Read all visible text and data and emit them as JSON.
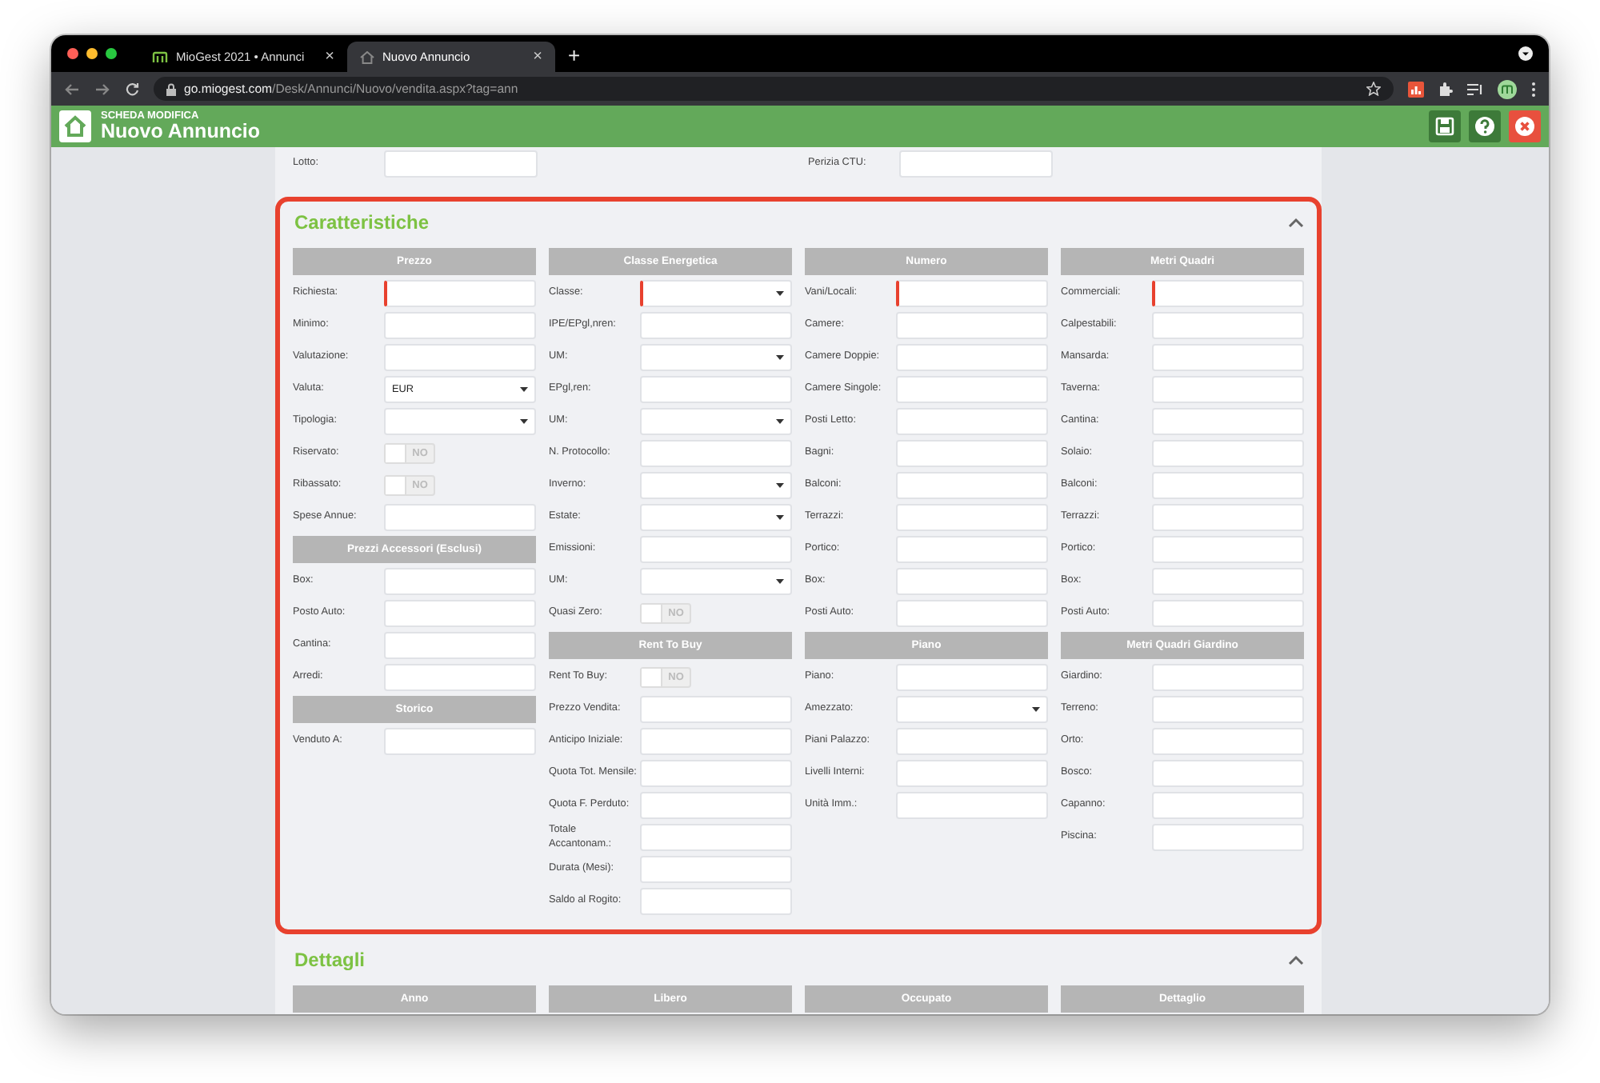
{
  "browser": {
    "tabs": [
      {
        "title": "MioGest 2021 • Annunci",
        "close": "×",
        "selected": false
      },
      {
        "title": "Nuovo Annuncio",
        "close": "×",
        "selected": true
      }
    ],
    "new_tab": "+",
    "url": {
      "host": "go.miogest.com",
      "path": "/Desk/Annunci/Nuovo/vendita.aspx?tag=ann"
    }
  },
  "header": {
    "subtitle": "SCHEDA MODIFICA",
    "title": "Nuovo Annuncio",
    "buttons": [
      {
        "kind": "save"
      },
      {
        "kind": "help"
      },
      {
        "kind": "close"
      }
    ]
  },
  "top_row": [
    {
      "label": "Lotto:",
      "kind": "text",
      "required": false
    },
    {
      "label": "Perizia CTU:",
      "kind": "text",
      "required": false
    }
  ],
  "sections": [
    {
      "title": "Caratteristiche",
      "expanded": true,
      "highlighted": true,
      "columns": [
        [
          {
            "heading": "Prezzo",
            "fields": [
              {
                "label": "Richiesta:",
                "kind": "text",
                "required": true
              },
              {
                "label": "Minimo:",
                "kind": "text",
                "required": false
              },
              {
                "label": "Valutazione:",
                "kind": "text",
                "required": false
              },
              {
                "label": "Valuta:",
                "kind": "select",
                "value": "EUR",
                "required": false
              },
              {
                "label": "Tipologia:",
                "kind": "select",
                "required": false
              },
              {
                "label": "Riservato:",
                "kind": "toggle",
                "text": "NO",
                "on": false
              },
              {
                "label": "Ribassato:",
                "kind": "toggle",
                "text": "NO",
                "on": false
              },
              {
                "label": "Spese Annue:",
                "kind": "text",
                "required": false
              }
            ]
          },
          {
            "heading": "Prezzi Accessori (Esclusi)",
            "fields": [
              {
                "label": "Box:",
                "kind": "text",
                "required": false
              },
              {
                "label": "Posto Auto:",
                "kind": "text",
                "required": false
              },
              {
                "label": "Cantina:",
                "kind": "text",
                "required": false
              },
              {
                "label": "Arredi:",
                "kind": "text",
                "required": false
              }
            ]
          },
          {
            "heading": "Storico",
            "fields": [
              {
                "label": "Venduto A:",
                "kind": "text",
                "required": false
              }
            ]
          }
        ],
        [
          {
            "heading": "Classe Energetica",
            "fields": [
              {
                "label": "Classe:",
                "kind": "select",
                "required": true
              },
              {
                "label": "IPE/EPgl,nren:",
                "kind": "text",
                "required": false
              },
              {
                "label": "UM:",
                "kind": "select",
                "required": false
              },
              {
                "label": "EPgl,ren:",
                "kind": "text",
                "required": false
              },
              {
                "label": "UM:",
                "kind": "select",
                "required": false
              },
              {
                "label": "N. Protocollo:",
                "kind": "text",
                "required": false
              },
              {
                "label": "Inverno:",
                "kind": "select",
                "required": false
              },
              {
                "label": "Estate:",
                "kind": "select",
                "required": false
              },
              {
                "label": "Emissioni:",
                "kind": "text",
                "required": false
              },
              {
                "label": "UM:",
                "kind": "select",
                "required": false
              },
              {
                "label": "Quasi Zero:",
                "kind": "toggle",
                "text": "NO",
                "on": false
              }
            ]
          },
          {
            "heading": "Rent To Buy",
            "fields": [
              {
                "label": "Rent To Buy:",
                "kind": "toggle",
                "text": "NO",
                "on": false
              },
              {
                "label": "Prezzo Vendita:",
                "kind": "text",
                "required": false
              },
              {
                "label": "Anticipo Iniziale:",
                "kind": "text",
                "required": false
              },
              {
                "label": "Quota Tot. Mensile:",
                "kind": "text",
                "required": false
              },
              {
                "label": "Quota F. Perduto:",
                "kind": "text",
                "required": false
              },
              {
                "label": "Totale Accantonam.:",
                "kind": "text",
                "required": false
              },
              {
                "label": "Durata (Mesi):",
                "kind": "text",
                "required": false
              },
              {
                "label": "Saldo al Rogito:",
                "kind": "text",
                "required": false
              }
            ]
          }
        ],
        [
          {
            "heading": "Numero",
            "fields": [
              {
                "label": "Vani/Locali:",
                "kind": "text",
                "required": true
              },
              {
                "label": "Camere:",
                "kind": "text",
                "required": false
              },
              {
                "label": "Camere Doppie:",
                "kind": "text",
                "required": false
              },
              {
                "label": "Camere Singole:",
                "kind": "text",
                "required": false
              },
              {
                "label": "Posti Letto:",
                "kind": "text",
                "required": false
              },
              {
                "label": "Bagni:",
                "kind": "text",
                "required": false
              },
              {
                "label": "Balconi:",
                "kind": "text",
                "required": false
              },
              {
                "label": "Terrazzi:",
                "kind": "text",
                "required": false
              },
              {
                "label": "Portico:",
                "kind": "text",
                "required": false
              },
              {
                "label": "Box:",
                "kind": "text",
                "required": false
              },
              {
                "label": "Posti Auto:",
                "kind": "text",
                "required": false
              }
            ]
          },
          {
            "heading": "Piano",
            "fields": [
              {
                "label": "Piano:",
                "kind": "text",
                "required": false
              },
              {
                "label": "Amezzato:",
                "kind": "select",
                "required": false
              },
              {
                "label": "Piani Palazzo:",
                "kind": "text",
                "required": false
              },
              {
                "label": "Livelli Interni:",
                "kind": "text",
                "required": false
              },
              {
                "label": "Unità Imm.:",
                "kind": "text",
                "required": false
              }
            ]
          }
        ],
        [
          {
            "heading": "Metri Quadri",
            "fields": [
              {
                "label": "Commerciali:",
                "kind": "text",
                "required": true
              },
              {
                "label": "Calpestabili:",
                "kind": "text",
                "required": false
              },
              {
                "label": "Mansarda:",
                "kind": "text",
                "required": false
              },
              {
                "label": "Taverna:",
                "kind": "text",
                "required": false
              },
              {
                "label": "Cantina:",
                "kind": "text",
                "required": false
              },
              {
                "label": "Solaio:",
                "kind": "text",
                "required": false
              },
              {
                "label": "Balconi:",
                "kind": "text",
                "required": false
              },
              {
                "label": "Terrazzi:",
                "kind": "text",
                "required": false
              },
              {
                "label": "Portico:",
                "kind": "text",
                "required": false
              },
              {
                "label": "Box:",
                "kind": "text",
                "required": false
              },
              {
                "label": "Posti Auto:",
                "kind": "text",
                "required": false
              }
            ]
          },
          {
            "heading": "Metri Quadri Giardino",
            "fields": [
              {
                "label": "Giardino:",
                "kind": "text",
                "required": false
              },
              {
                "label": "Terreno:",
                "kind": "text",
                "required": false
              },
              {
                "label": "Orto:",
                "kind": "text",
                "required": false
              },
              {
                "label": "Bosco:",
                "kind": "text",
                "required": false
              },
              {
                "label": "Capanno:",
                "kind": "text",
                "required": false
              },
              {
                "label": "Piscina:",
                "kind": "text",
                "required": false
              }
            ]
          }
        ]
      ]
    },
    {
      "title": "Dettagli",
      "expanded": true,
      "highlighted": false,
      "columns": [
        [
          {
            "heading": "Anno"
          }
        ],
        [
          {
            "heading": "Libero"
          }
        ],
        [
          {
            "heading": "Occupato"
          }
        ],
        [
          {
            "heading": "Dettaglio"
          }
        ]
      ]
    }
  ]
}
